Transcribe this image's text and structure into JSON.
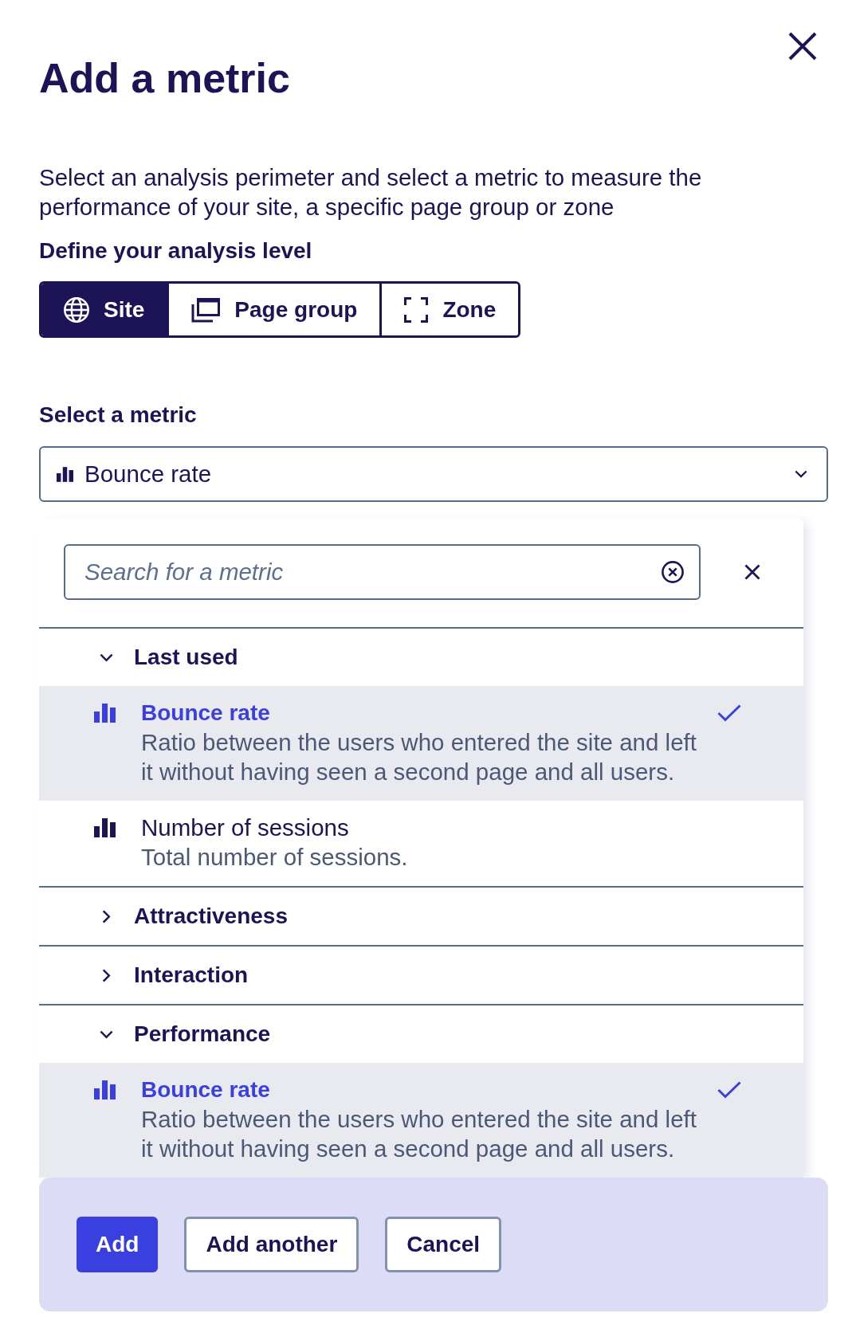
{
  "dialog": {
    "title": "Add a metric",
    "description": "Select an analysis perimeter and select a metric to measure the performance of your site, a specific page group or zone"
  },
  "analysis_level": {
    "label": "Define your analysis level",
    "options": [
      {
        "label": "Site",
        "selected": true
      },
      {
        "label": "Page group",
        "selected": false
      },
      {
        "label": "Zone",
        "selected": false
      }
    ]
  },
  "metric_select": {
    "label": "Select a metric",
    "value": "Bounce rate",
    "expanded": true,
    "search": {
      "placeholder": "Search for a metric"
    },
    "groups": [
      {
        "title": "Last used",
        "expanded": true,
        "items": [
          {
            "name": "Bounce rate",
            "description": "Ratio between the users who entered the site and left it without having seen a second page and all users.",
            "selected": true
          },
          {
            "name": "Number of sessions",
            "description": "Total number of sessions.",
            "selected": false
          }
        ]
      },
      {
        "title": "Attractiveness",
        "expanded": false
      },
      {
        "title": "Interaction",
        "expanded": false
      },
      {
        "title": "Performance",
        "expanded": true,
        "items": [
          {
            "name": "Bounce rate",
            "description": "Ratio between the users who entered the site and left it without having seen a second page and all users.",
            "selected": true
          }
        ]
      }
    ]
  },
  "footer": {
    "buttons": [
      {
        "label": "Add",
        "kind": "primary"
      },
      {
        "label": "Add another",
        "kind": "secondary"
      },
      {
        "label": "Cancel",
        "kind": "secondary"
      }
    ]
  }
}
